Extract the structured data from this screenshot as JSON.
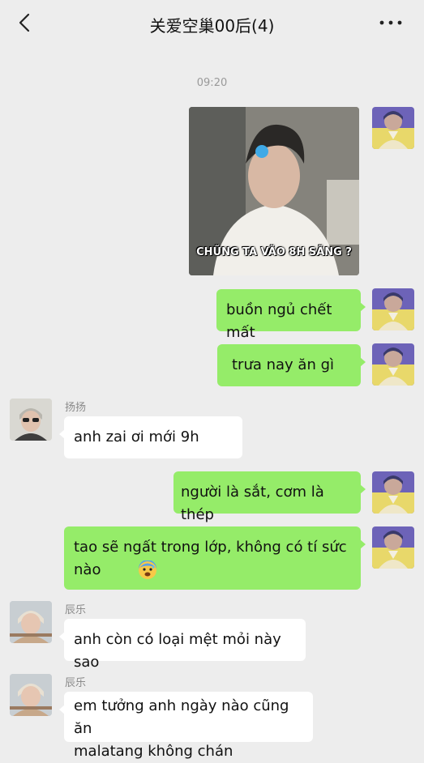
{
  "header": {
    "title": "关爱空巢00后(4)"
  },
  "timestamp": "09:20",
  "image_message": {
    "caption": "CHŨNG TA VÃO 8H SÃNG ?"
  },
  "messages": [
    {
      "sender": "me",
      "text": "buồn ngủ chết mất"
    },
    {
      "sender": "me",
      "text": "trưa nay ăn gì"
    },
    {
      "sender": "扬扬",
      "name": "扬扬",
      "text": "anh zai ơi mới 9h"
    },
    {
      "sender": "me",
      "text": "người là sắt, cơm là thép"
    },
    {
      "sender": "me",
      "text_line1": "tao sẽ ngất trong lớp, không có tí sức",
      "text_line2": "nào"
    },
    {
      "sender": "辰乐",
      "name": "辰乐",
      "text": "anh còn có loại mệt mỏi này sao"
    },
    {
      "sender": "辰乐",
      "name": "辰乐",
      "text_line1": "em tưởng anh ngày nào cũng ăn",
      "text_line2": "malatang không chán"
    }
  ],
  "colors": {
    "background": "#ededed",
    "my_bubble": "#95ec69",
    "other_bubble": "#ffffff"
  }
}
